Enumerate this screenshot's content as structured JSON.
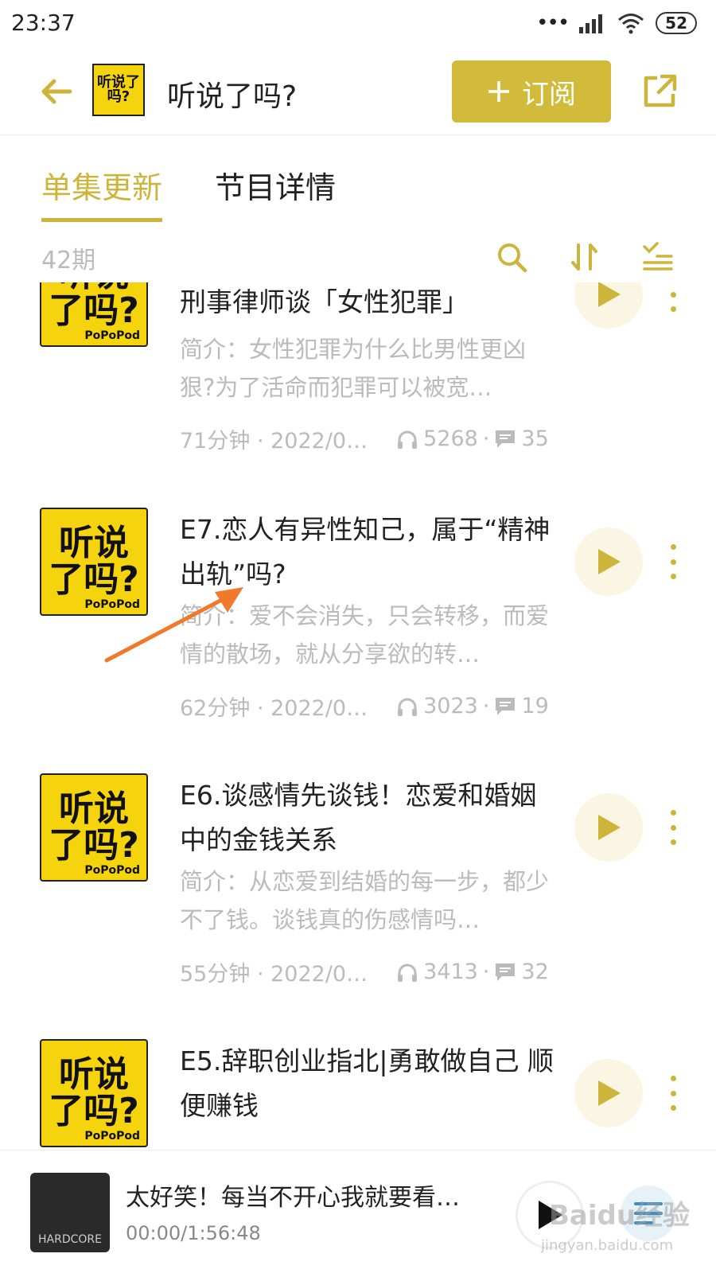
{
  "status_bar": {
    "time": "23:37",
    "battery": "52"
  },
  "header": {
    "title": "听说了吗?",
    "cover_text": "听说了吗?",
    "subscribe_label": "订阅"
  },
  "tabs": [
    {
      "label": "单集更新"
    },
    {
      "label": "节目详情"
    }
  ],
  "toolbar": {
    "episode_count": "42期"
  },
  "episodes": [
    {
      "cover_line1": "听说",
      "cover_line2": "了吗?",
      "cover_brand": "PoPoPod",
      "title": "刑事律师谈「女性犯罪」",
      "description": "简介：女性犯罪为什么比男性更凶狠?为了活命而犯罪可以被宽…",
      "duration": "71分钟 · 2022/0…",
      "plays": "5268",
      "comments": "35"
    },
    {
      "cover_line1": "听说",
      "cover_line2": "了吗?",
      "cover_brand": "PoPoPod",
      "title": "E7.恋人有异性知己，属于“精神出轨”吗?",
      "description": "简介：爱不会消失，只会转移，而爱情的散场，就从分享欲的转…",
      "duration": "62分钟 · 2022/0…",
      "plays": "3023",
      "comments": "19"
    },
    {
      "cover_line1": "听说",
      "cover_line2": "了吗?",
      "cover_brand": "PoPoPod",
      "title": "E6.谈感情先谈钱！恋爱和婚姻中的金钱关系",
      "description": "简介：从恋爱到结婚的每一步，都少不了钱。谈钱真的伤感情吗…",
      "duration": "55分钟 · 2022/0…",
      "plays": "3413",
      "comments": "32"
    },
    {
      "cover_line1": "听说",
      "cover_line2": "了吗?",
      "cover_brand": "PoPoPod",
      "title": "E5.辞职创业指北|勇敢做自己 顺便赚钱",
      "description": "",
      "duration": "",
      "plays": "",
      "comments": ""
    }
  ],
  "player": {
    "cover_text": "HARDCORE",
    "title": "太好笑！每当不开心我就要看…",
    "time": "00:00/1:56:48"
  },
  "watermark": {
    "text": "Baidu经验",
    "sub": "jingyan.baidu.com"
  },
  "colors": {
    "accent": "#cdb43a",
    "button": "#d2bb3a",
    "cover_yellow": "#f6d40d",
    "arrow": "#f07a2a"
  }
}
